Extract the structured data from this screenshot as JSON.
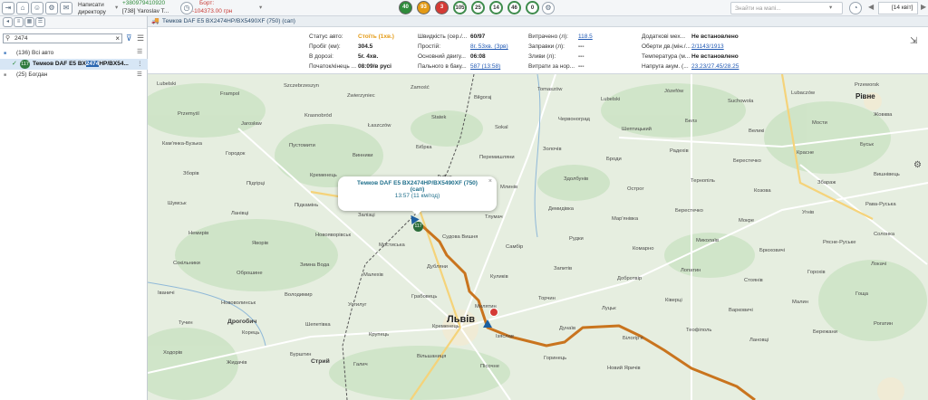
{
  "toolbar": {
    "phone": "+380979410920",
    "user": "[738] Yaroslav T...",
    "director_line1": "Написати",
    "director_line2": "директору",
    "board_label": "Борт:",
    "board_balance": "-104373.00 грн",
    "counters": [
      {
        "value": "40",
        "color": "#2f8b3b"
      },
      {
        "value": "93",
        "color": "#e49a14"
      },
      {
        "value": "3",
        "color": "#d43a35"
      },
      {
        "value": "105",
        "color": "#ffffff"
      },
      {
        "value": "25",
        "color": "#ffffff"
      },
      {
        "value": "14",
        "color": "#ffffff"
      },
      {
        "value": "46",
        "color": "#ffffff"
      },
      {
        "value": "0",
        "color": "#ffffff"
      }
    ],
    "search_placeholder": "Знайти на мапі...",
    "date": "[14 квіт]"
  },
  "sidebar": {
    "search_value": "2474",
    "groups": [
      {
        "label": "(136) Всі авто"
      },
      {
        "badge": "117",
        "label_a": "Темков DAF E5 BX",
        "label_hl": "2474",
        "label_b": "HP/BX54..."
      },
      {
        "label": "(25) Богдан"
      }
    ]
  },
  "vehicle_header": "Темков DAF E5 BX2474HP/BX5490XF (750) (сап)",
  "info": {
    "col1": [
      {
        "label": "Статус авто:",
        "value": "Стоїть (1хв.)",
        "status": true
      },
      {
        "label": "Пробіг (км):",
        "value": "304.5"
      },
      {
        "label": "В дорозі:",
        "value": "5г. 4хв."
      },
      {
        "label": "Початок/кінець ...",
        "value": "08:09/в русі"
      }
    ],
    "col2": [
      {
        "label": "Швидкість (сер./...",
        "value": "60/97"
      },
      {
        "label": "Простій:",
        "value": "8г. 53хв. (Зрв)",
        "link": true
      },
      {
        "label": "Основний двигу...",
        "value": "06:08"
      },
      {
        "label": "Пального в баку...",
        "value": "587 (13:58)",
        "link": true
      }
    ],
    "col3": [
      {
        "label": "Витрачено (л):",
        "value": "118.5",
        "link": true
      },
      {
        "label": "Заправки (л):",
        "value": "---"
      },
      {
        "label": "Зливи (л):",
        "value": "---"
      },
      {
        "label": "Витрати за нор...",
        "value": "---"
      }
    ],
    "col4": [
      {
        "label": "Додаткові мех...",
        "value": "Не встановлено"
      },
      {
        "label": "Оберти дв.(мін./...",
        "value": "2/1143/1913",
        "link": true
      },
      {
        "label": "Температура (м...",
        "value": "Не встановлено"
      },
      {
        "label": "Напруга акум. (...",
        "value": "23.23/27.45/28.25",
        "link": true
      }
    ]
  },
  "map": {
    "popup_title": "Темков DAF E5 BX2474HP/BX5490XF (750)",
    "popup_sub": "(сап)",
    "popup_time": "13:57 (11 км/год)",
    "marker_badge": "117",
    "cities": [
      {
        "name": "Львів"
      },
      {
        "name": "Рівне"
      }
    ],
    "towns": [
      {
        "name": "Дрогобич"
      },
      {
        "name": "Стрий"
      }
    ],
    "places": [
      "Lubelski",
      "Frampol",
      "Szczebrzeszyn",
      "Zwierzyniec",
      "Zamość",
      "Biłgoraj",
      "Tomaszów",
      "Lubelski",
      "Józefów",
      "Suchowola",
      "Lubaczów",
      "Przeworsk",
      "Przemyśl",
      "Jarosław",
      "Krasnobród",
      "Łaszczów",
      "Statek",
      "Sokal",
      "Червоноград",
      "Шептицький",
      "Белз",
      "Великі",
      "Мости",
      "Жовква",
      "Кам'янка-Бузька",
      "Городок",
      "Пустомити",
      "Винники",
      "Бібрка",
      "Перемишляни",
      "Золочів",
      "Броди",
      "Радехів",
      "Берестечко",
      "Красне",
      "Буськ",
      "Зборів",
      "Підгірці",
      "Кременець",
      "Почаїв",
      "Дубно",
      "Млинів",
      "Здолбунів",
      "Острог",
      "Тернопіль",
      "Козова",
      "Збараж",
      "Вишнівець",
      "Шумськ",
      "Ланівці",
      "Підкамінь",
      "Залізці",
      "Поморяни",
      "Тлумач",
      "Демидівка",
      "Мар'янівка",
      "Берестечко",
      "Мокре",
      "Угнів",
      "Рава-Руська",
      "Немирів",
      "Яворів",
      "Новояворівськ",
      "Мостиська",
      "Судова Вишня",
      "Самбір",
      "Рудки",
      "Комарно",
      "Миколаїв",
      "Брюховичі",
      "Рясне-Руське",
      "Солонка",
      "Сокільники",
      "Оброшине",
      "Зимна Вода",
      "Малехів",
      "Дубляни",
      "Куликів",
      "Запитів",
      "Добротвір",
      "Лопатин",
      "Стоянів",
      "Горохів",
      "Локачі",
      "Іваничі",
      "Нововолинськ",
      "Володимир",
      "Устилуг",
      "Грабовець",
      "Милятин",
      "Торчин",
      "Луцьк",
      "Ківерці",
      "Варковичі",
      "Малин",
      "Гоща",
      "Тучин",
      "Корець",
      "Шепетівка",
      "Крупець",
      "Кременець",
      "Ізяслав",
      "Дунаїв",
      "Білогір'я",
      "Теофіполь",
      "Лановці",
      "Бережани",
      "Рогатин",
      "Ходорів",
      "Жидачів",
      "Бурштин",
      "Галич",
      "Вільшаниця",
      "Пісочне",
      "Горинець",
      "Новий Яричів"
    ]
  }
}
